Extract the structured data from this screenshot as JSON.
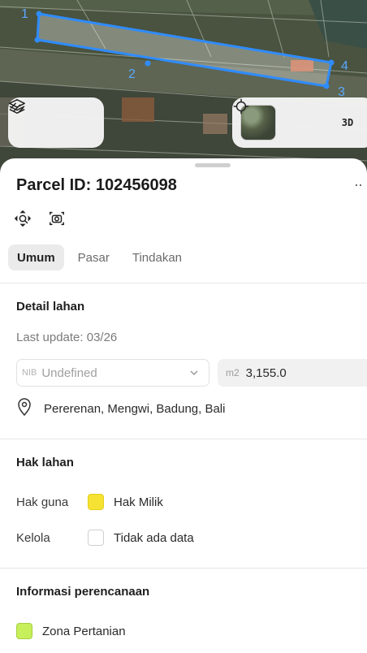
{
  "map": {
    "parcel_vertex_labels": [
      "1",
      "2",
      "3",
      "4"
    ],
    "parcel_color": "#2f8cff",
    "controls_left": [
      {
        "name": "layers-icon"
      },
      {
        "name": "measure-icon"
      }
    ],
    "controls_right": {
      "satellite_thumbnail": "satellite-basemap",
      "locate": "crosshair-icon",
      "view_3d_label": "3D"
    }
  },
  "sheet": {
    "title": "Parcel ID: 102456098",
    "more_label": "··",
    "actions": [
      {
        "name": "zoom-to-parcel-icon"
      },
      {
        "name": "screenshot-icon"
      }
    ],
    "tabs": [
      {
        "label": "Umum",
        "active": true
      },
      {
        "label": "Pasar",
        "active": false
      },
      {
        "label": "Tindakan",
        "active": false
      }
    ],
    "detail": {
      "title": "Detail lahan",
      "last_update": "Last update: 03/26",
      "nib_prefix": "NIB",
      "nib_value": "Undefined",
      "area_prefix": "m2",
      "area_value": "3,155.0",
      "location": "Pererenan, Mengwi, Badung, Bali"
    },
    "rights": {
      "title": "Hak lahan",
      "rows": [
        {
          "label": "Hak guna",
          "value": "Hak Milik",
          "color": "#f6e233"
        },
        {
          "label": "Kelola",
          "value": "Tidak ada data",
          "color": "#ffffff"
        }
      ]
    },
    "planning": {
      "title": "Informasi perencanaan",
      "zone": "Zona Pertanian",
      "zone_color": "#c6ef5b"
    }
  }
}
